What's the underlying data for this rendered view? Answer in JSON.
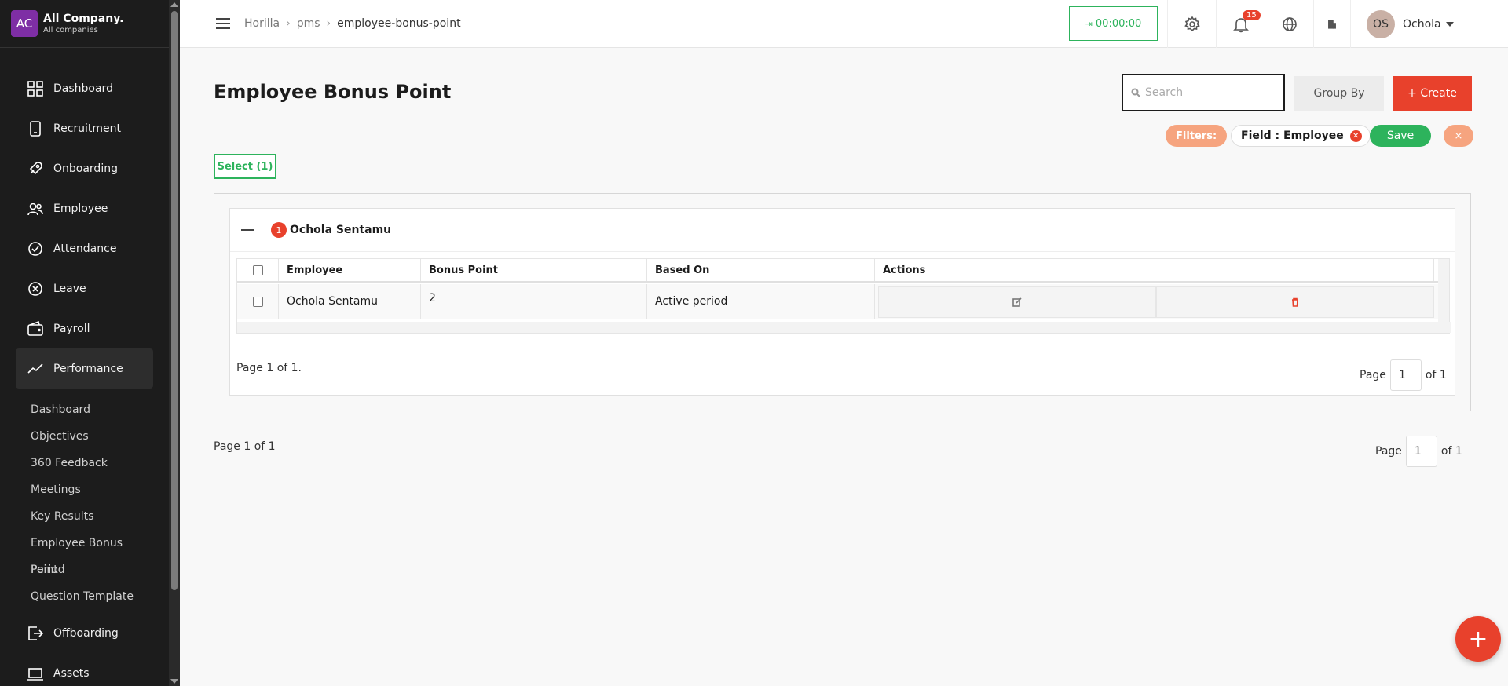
{
  "brand": {
    "logo": "AC",
    "name": "All Company.",
    "sub": "All companies"
  },
  "sidebar": {
    "items": [
      {
        "label": "Dashboard",
        "icon": "grid-icon"
      },
      {
        "label": "Recruitment",
        "icon": "phone-icon"
      },
      {
        "label": "Onboarding",
        "icon": "rocket-icon"
      },
      {
        "label": "Employee",
        "icon": "users-icon"
      },
      {
        "label": "Attendance",
        "icon": "check-circle-icon"
      },
      {
        "label": "Leave",
        "icon": "x-circle-icon"
      },
      {
        "label": "Payroll",
        "icon": "wallet-icon"
      },
      {
        "label": "Performance",
        "icon": "trend-icon"
      }
    ],
    "performance_sub": [
      "Dashboard",
      "Objectives",
      "360 Feedback",
      "Meetings",
      "Key Results",
      "Employee Bonus Point",
      "Period",
      "Question Template"
    ],
    "after": [
      {
        "label": "Offboarding",
        "icon": "exit-icon"
      },
      {
        "label": "Assets",
        "icon": "laptop-icon"
      }
    ]
  },
  "header": {
    "breadcrumb": [
      "Horilla",
      "pms",
      "employee-bonus-point"
    ],
    "timer": "00:00:00",
    "notifications": "15",
    "user": {
      "initials": "OS",
      "name": "Ochola"
    }
  },
  "page": {
    "title": "Employee Bonus Point",
    "search_placeholder": "Search",
    "group_by": "Group By",
    "create": "+ Create",
    "filters_label": "Filters:",
    "filter_chip": "Field : Employee",
    "save": "Save",
    "clear": "×",
    "select": "Select (1)"
  },
  "group": {
    "count": "1",
    "name": "Ochola Sentamu",
    "columns": [
      "Employee",
      "Bonus Point",
      "Based On",
      "Actions"
    ],
    "rows": [
      {
        "employee": "Ochola Sentamu",
        "bonus_point": "2",
        "based_on": "Active period"
      }
    ],
    "page_text": "Page 1 of 1.",
    "page_label": "Page",
    "page_value": "1",
    "page_of": "of 1"
  },
  "footer": {
    "page_text": "Page 1 of 1",
    "page_label": "Page",
    "page_value": "1",
    "page_of": "of 1"
  },
  "colors": {
    "accent": "#e8412c",
    "success": "#2db35c",
    "sidebar": "#1c1c1c"
  }
}
